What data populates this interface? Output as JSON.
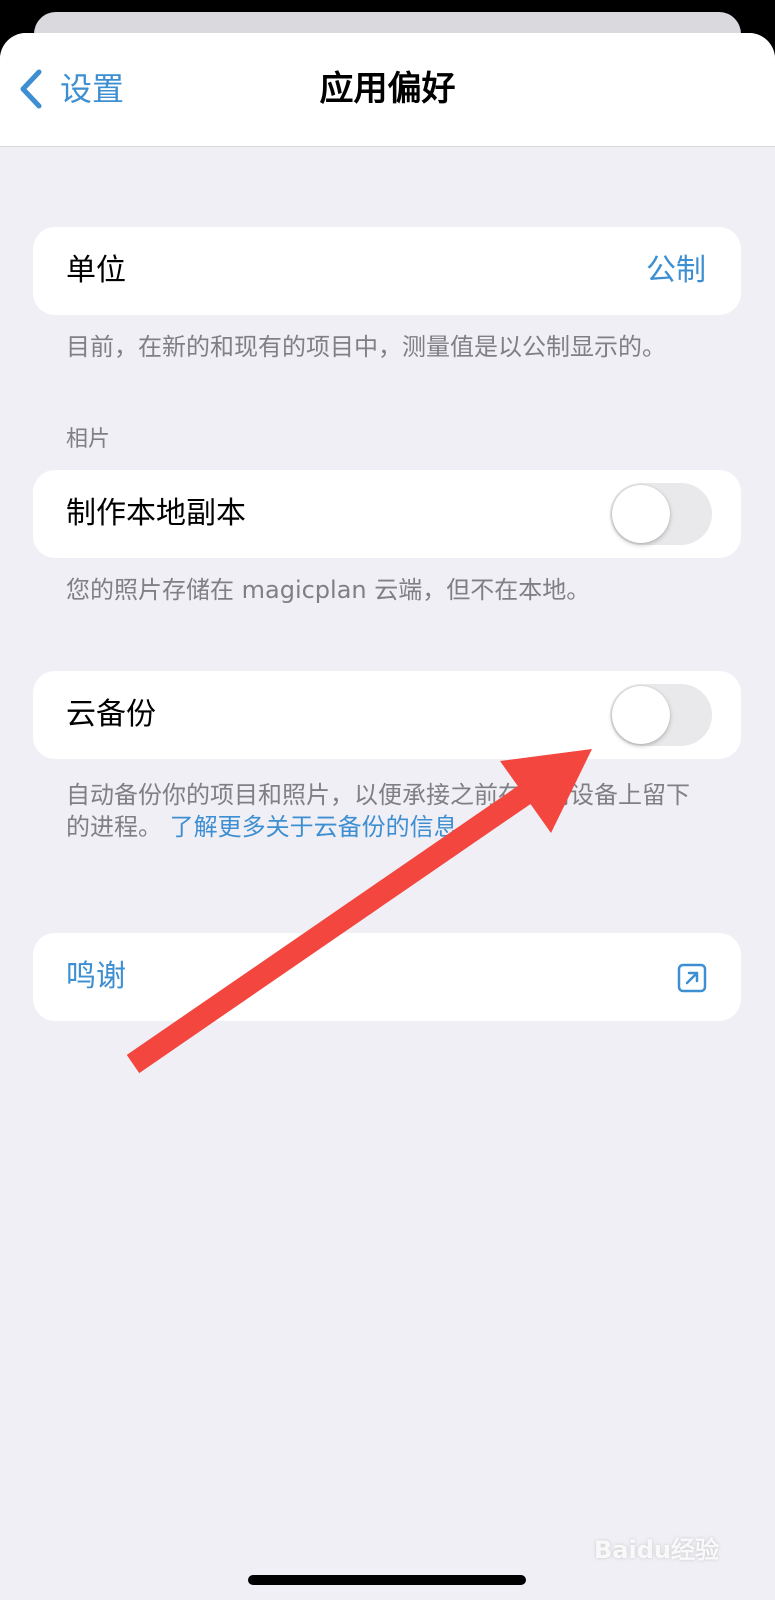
{
  "nav": {
    "back_label": "设置",
    "title": "应用偏好"
  },
  "units": {
    "label": "单位",
    "value": "公制",
    "footer": "目前，在新的和现有的项目中，测量值是以公制显示的。"
  },
  "photos": {
    "section_title": "相片",
    "local_copy_label": "制作本地副本",
    "local_copy_enabled": false,
    "footer": "您的照片存储在 magicplan 云端，但不在本地。"
  },
  "cloud_backup": {
    "label": "云备份",
    "enabled": false,
    "footer_prefix": "自动备份你的项目和照片，以便承接之前在任何设备上留下的进程。",
    "footer_link": "了解更多关于云备份的信息..."
  },
  "credits": {
    "label": "鸣谢"
  },
  "annotation": {
    "arrow_color": "#f2463f"
  },
  "watermark": {
    "text": "Baidu经验"
  },
  "colors": {
    "accent": "#3d8fd1",
    "background": "#f0eff5",
    "card": "#ffffff",
    "secondary_text": "#7f7f84"
  }
}
